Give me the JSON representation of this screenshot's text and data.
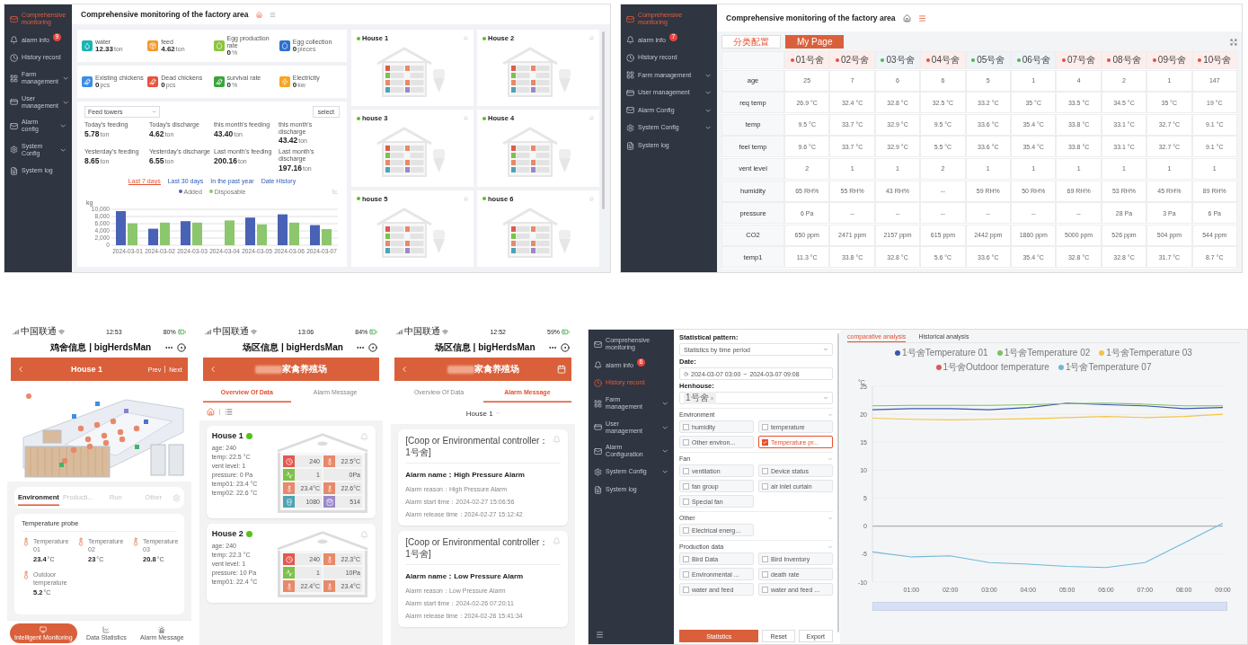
{
  "dashboard": {
    "sidebar": {
      "items": [
        {
          "label": "Comprehensive monitoring",
          "selected": true,
          "expandable": false
        },
        {
          "label": "alarm info",
          "badge": "9",
          "selected": false,
          "expandable": false
        },
        {
          "label": "History record",
          "selected": false,
          "expandable": false
        },
        {
          "label": "Farm management",
          "selected": false,
          "expandable": true
        },
        {
          "label": "User management",
          "selected": false,
          "expandable": true
        },
        {
          "label": "Alarm config",
          "selected": false,
          "expandable": true
        },
        {
          "label": "System Config",
          "selected": false,
          "expandable": true
        },
        {
          "label": "System log",
          "selected": false,
          "expandable": false
        }
      ]
    },
    "title": "Comprehensive monitoring of the factory area",
    "stat_groups": [
      [
        {
          "label": "water",
          "value": "12.33",
          "unit": "ton",
          "color": "#1bb3b3"
        },
        {
          "label": "feed",
          "value": "4.62",
          "unit": "ton",
          "color": "#f39a2b"
        },
        {
          "label": "Egg production rate",
          "value": "0",
          "unit": "%",
          "color": "#8cc43f"
        },
        {
          "label": "Egg collection",
          "value": "0",
          "unit": "pieces",
          "color": "#2f6fd1"
        }
      ],
      [
        {
          "label": "Existing chickens",
          "value": "0",
          "unit": "pcs",
          "color": "#3a8ee6"
        },
        {
          "label": "Dead chickens",
          "value": "0",
          "unit": "pcs",
          "color": "#e8533b"
        },
        {
          "label": "survival rate",
          "value": "0",
          "unit": "%",
          "color": "#3aa43a"
        },
        {
          "label": "Electricity",
          "value": "0",
          "unit": "kw",
          "color": "#f5a623"
        }
      ]
    ],
    "feed_panel": {
      "select": "Feed towers",
      "button": "select",
      "metrics": [
        {
          "label": "Today's feeding",
          "value": "5.78",
          "unit": "ton"
        },
        {
          "label": "Today's discharge",
          "value": "4.62",
          "unit": "ton"
        },
        {
          "label": "this month's feeding",
          "value": "43.40",
          "unit": "ton"
        },
        {
          "label": "this month's discharge",
          "value": "43.42",
          "unit": "ton"
        },
        {
          "label": "Yesterday's feeding",
          "value": "8.65",
          "unit": "ton"
        },
        {
          "label": "Yesterday's discharge",
          "value": "6.55",
          "unit": "ton"
        },
        {
          "label": "Last month's feeding",
          "value": "200.16",
          "unit": "ton"
        },
        {
          "label": "Last month's discharge",
          "value": "197.16",
          "unit": "ton"
        }
      ],
      "chart_tabs": [
        {
          "label": "Last 7 days",
          "selected": true
        },
        {
          "label": "Last 30 days",
          "selected": false
        },
        {
          "label": "In the past year",
          "selected": false
        },
        {
          "label": "Date History",
          "selected": false
        }
      ],
      "chart_data": {
        "type": "bar",
        "grid": true,
        "ylabel": "kg",
        "categories": [
          "2024-03-01",
          "2024-03-02",
          "2024-03-03",
          "2024-03-04",
          "2024-03-05",
          "2024-03-06",
          "2024-03-07"
        ],
        "series": [
          {
            "name": "Added",
            "color": "#4a62b5",
            "values": [
              9500,
              4600,
              6700,
              null,
              7700,
              8600,
              5600
            ]
          },
          {
            "name": "Disposable",
            "color": "#8cc66d",
            "values": [
              6100,
              6300,
              6300,
              6900,
              5800,
              6300,
              4500
            ]
          }
        ],
        "ylim": [
          0,
          10000
        ],
        "yticks": [
          0,
          {
            "value": 2000,
            "label": "2,000"
          },
          {
            "value": 4000,
            "label": "4,000"
          },
          {
            "value": 6000,
            "label": "6,000"
          },
          {
            "value": 8000,
            "label": "8,000"
          },
          {
            "value": 10000,
            "label": "10,000"
          }
        ]
      }
    },
    "houses": [
      {
        "name": "House 1",
        "online": true
      },
      {
        "name": "House 2",
        "online": true
      },
      {
        "name": "house 3",
        "online": true
      },
      {
        "name": "House 4",
        "online": true
      },
      {
        "name": "house 5",
        "online": true
      },
      {
        "name": "house 6",
        "online": true
      }
    ]
  },
  "house_table": {
    "sidebar": {
      "items": [
        {
          "label": "Comprehensive monitoring",
          "selected": true,
          "expandable": false
        },
        {
          "label": "alarm info",
          "badge": "7",
          "selected": false,
          "expandable": false
        },
        {
          "label": "History record",
          "selected": false,
          "expandable": false
        },
        {
          "label": "Farm management",
          "selected": false,
          "expandable": true
        },
        {
          "label": "User management",
          "selected": false,
          "expandable": true
        },
        {
          "label": "Alarm Config",
          "selected": false,
          "expandable": true
        },
        {
          "label": "System Config",
          "selected": false,
          "expandable": true
        },
        {
          "label": "System log",
          "selected": false,
          "expandable": false
        }
      ]
    },
    "title": "Comprehensive monitoring of the factory area",
    "buttons": [
      {
        "label": "分类配置",
        "selected": false
      },
      {
        "label": "My Page",
        "selected": true
      }
    ],
    "columns": [
      {
        "label": "01号舍",
        "color": "#e84a4a"
      },
      {
        "label": "02号舍",
        "color": "#e84a4a"
      },
      {
        "label": "03号舍",
        "color": "#4cb648"
      },
      {
        "label": "04号舍",
        "color": "#e84a4a"
      },
      {
        "label": "05号舍",
        "color": "#4cb648"
      },
      {
        "label": "06号舍",
        "color": "#4cb648"
      },
      {
        "label": "07号舍",
        "color": "#e84a4a"
      },
      {
        "label": "08号舍",
        "color": "#e84a4a"
      },
      {
        "label": "09号舍",
        "color": "#e84a4a"
      },
      {
        "label": "10号舍",
        "color": "#e84a4a"
      }
    ],
    "rows": [
      {
        "label": "age",
        "cells": [
          "25",
          "7",
          "6",
          "6",
          "5",
          "1",
          "4",
          "2",
          "1",
          "147"
        ]
      },
      {
        "label": "req temp",
        "cells": [
          "26.9 °C",
          "32.4 °C",
          "32.8 °C",
          "32.5 °C",
          "33.2 °C",
          "35 °C",
          "33.5 °C",
          "34.5 °C",
          "35 °C",
          "19 °C"
        ]
      },
      {
        "label": "temp",
        "cells": [
          "9.5 °C",
          "33.7 °C",
          "32.9 °C",
          "9.5 °C",
          "33.6 °C",
          "35.4 °C",
          "33.8 °C",
          "33.1 °C",
          "32.7 °C",
          "9.1 °C"
        ]
      },
      {
        "label": "feel temp",
        "cells": [
          "9.6 °C",
          "33.7 °C",
          "32.9 °C",
          "5.5 °C",
          "33.6 °C",
          "35.4 °C",
          "33.8 °C",
          "33.1 °C",
          "32.7 °C",
          "9.1 °C"
        ]
      },
      {
        "label": "vent level",
        "cells": [
          "2",
          "1",
          "1",
          "2",
          "1",
          "1",
          "1",
          "1",
          "1",
          "1"
        ]
      },
      {
        "label": "humidity",
        "cells": [
          "65 RH%",
          "55 RH%",
          "43 RH%",
          "--",
          "59 RH%",
          "50 RH%",
          "69 RH%",
          "53 RH%",
          "45 RH%",
          "89 RH%"
        ]
      },
      {
        "label": "pressure",
        "cells": [
          "6 Pa",
          "--",
          "--",
          "--",
          "--",
          "--",
          "--",
          "28 Pa",
          "3 Pa",
          "6 Pa"
        ]
      },
      {
        "label": "CO2",
        "cells": [
          "650 ppm",
          "2471 ppm",
          "2157 ppm",
          "615 ppm",
          "2442 ppm",
          "1860 ppm",
          "5000 ppm",
          "526 ppm",
          "504 ppm",
          "544 ppm"
        ]
      },
      {
        "label": "temp1",
        "cells": [
          "11.3 °C",
          "33.8 °C",
          "32.8 °C",
          "5.6 °C",
          "33.6 °C",
          "35.4 °C",
          "32.8 °C",
          "32.8 °C",
          "31.7 °C",
          "8.7 °C"
        ]
      }
    ]
  },
  "phones": [
    {
      "kind": "house",
      "status": {
        "carrier": "中国联通",
        "time": "12:53",
        "battery": "80%"
      },
      "app_title": "鸡舍信息 | bigHerdsMan",
      "header": {
        "title": "House 1",
        "prev": "Prev",
        "next": "Next"
      },
      "tabs": [
        {
          "label": "Environment",
          "selected": true
        },
        {
          "label": "Producti...",
          "selected": false
        },
        {
          "label": "Run",
          "selected": false
        },
        {
          "label": "Other",
          "selected": false
        }
      ],
      "probe_card": {
        "title": "Temperature probe",
        "probes": [
          {
            "label": "Temperature 01",
            "value": "23.4",
            "unit": "°C"
          },
          {
            "label": "Temperature 02",
            "value": "23",
            "unit": "°C"
          },
          {
            "label": "Temperature 03",
            "value": "20.8",
            "unit": "°C"
          },
          {
            "label": "Outdoor temperature",
            "value": "5.2",
            "unit": "°C"
          }
        ]
      },
      "nav": [
        {
          "label": "Intelligent Monitoring",
          "selected": true
        },
        {
          "label": "Data Statistics",
          "selected": false
        },
        {
          "label": "Alarm Message",
          "selected": false
        }
      ]
    },
    {
      "kind": "overview",
      "status": {
        "carrier": "中国联通",
        "time": "13:06",
        "battery": "84%"
      },
      "app_title": "场区信息 | bigHerdsMan",
      "header": {
        "title": "家禽养殖场"
      },
      "tabs": [
        {
          "label": "Overview Of Data",
          "selected": true
        },
        {
          "label": "Alarm Message",
          "selected": false
        }
      ],
      "houses": [
        {
          "name": "House 1",
          "online": true,
          "details": [
            "age: 240",
            "temp: 22.5 °C",
            "vent level: 1",
            "pressure: 0 Pa",
            "temp01: 23.4 °C",
            "temp02: 22.6 °C"
          ],
          "cells": [
            "240",
            "22.5°C",
            "1",
            "0Pa",
            "23.4°C",
            "22.6°C",
            "1080",
            "514"
          ]
        },
        {
          "name": "House 2",
          "online": true,
          "details": [
            "age: 240",
            "temp: 22.3 °C",
            "vent level: 1",
            "pressure: 10 Pa",
            "temp01: 22.4 °C"
          ],
          "cells": [
            "240",
            "22.3°C",
            "1",
            "10Pa",
            "22.4°C",
            "23.4°C"
          ]
        }
      ]
    },
    {
      "kind": "alarms",
      "status": {
        "carrier": "中国联通",
        "time": "12:52",
        "battery": "59%"
      },
      "app_title": "场区信息 | bigHerdsMan",
      "header": {
        "title": "家禽养殖场"
      },
      "tabs": [
        {
          "label": "Overview Of Data",
          "selected": false
        },
        {
          "label": "Alarm Message",
          "selected": true
        }
      ],
      "house_select": "House 1",
      "alarms": [
        {
          "source": "[Coop or Environmental controller：1号舍]",
          "name": "Alarm name：High Pressure Alarm",
          "lines": [
            "Alarm reason：High Pressure Alarm",
            "Alarm start time：2024-02-27 15:06:56",
            "Alarm release time：2024-02-27 15:12:42"
          ]
        },
        {
          "source": "[Coop or Environmental controller：1号舍]",
          "name": "Alarm name：Low Pressure Alarm",
          "lines": [
            "Alarm reason：Low Pressure Alarm",
            "Alarm start time：2024-02-26 07:20:11",
            "Alarm release time：2024-02-26 15:41:34"
          ]
        }
      ]
    }
  ],
  "history": {
    "sidebar": {
      "items": [
        {
          "label": "Comprehensive monitoring",
          "selected": false,
          "expandable": false
        },
        {
          "label": "alarm info",
          "badge": "6",
          "selected": false,
          "expandable": false
        },
        {
          "label": "History record",
          "selected": true,
          "expandable": false
        },
        {
          "label": "Farm management",
          "selected": false,
          "expandable": true
        },
        {
          "label": "User management",
          "selected": false,
          "expandable": true
        },
        {
          "label": "Alarm Configuration",
          "selected": false,
          "expandable": true
        },
        {
          "label": "System Config",
          "selected": false,
          "expandable": true
        },
        {
          "label": "System log",
          "selected": false,
          "expandable": false
        }
      ]
    },
    "pattern_label": "Statistical pattern:",
    "pattern": "Statistics by time period",
    "date_label": "Date:",
    "date_start": "2024-03-07 03:00",
    "date_sep": "~",
    "date_end": "2024-03-07 09:08",
    "henhouse_label": "Henhouse:",
    "henhouse_tag": "1号舍",
    "sections": [
      {
        "title": "Environment",
        "options": [
          {
            "label": "humidity",
            "checked": false
          },
          {
            "label": "temperature",
            "checked": false
          },
          {
            "label": "Other environ...",
            "checked": false
          },
          {
            "label": "Temperature pr...",
            "checked": true
          }
        ]
      },
      {
        "title": "Fan",
        "options": [
          {
            "label": "ventilation",
            "checked": false
          },
          {
            "label": "Device status",
            "checked": false
          },
          {
            "label": "fan group",
            "checked": false
          },
          {
            "label": "air inlet curtain",
            "checked": false
          },
          {
            "label": "Special fan",
            "checked": false
          }
        ]
      },
      {
        "title": "Other",
        "options": [
          {
            "label": "Electrical energ...",
            "checked": false
          }
        ]
      },
      {
        "title": "Production data",
        "options": [
          {
            "label": "Bird Data",
            "checked": false
          },
          {
            "label": "Bird Inventory",
            "checked": false
          },
          {
            "label": "Environmental ...",
            "checked": false
          },
          {
            "label": "death rate",
            "checked": false
          },
          {
            "label": "water and feed",
            "checked": false
          },
          {
            "label": "water and feed ...",
            "checked": false
          }
        ]
      }
    ],
    "buttons": [
      {
        "label": "Statistics",
        "primary": true
      },
      {
        "label": "Reset",
        "primary": false
      },
      {
        "label": "Export",
        "primary": false
      }
    ],
    "tabs": [
      {
        "label": "comparative analysis",
        "selected": true
      },
      {
        "label": "Historical analysis",
        "selected": false
      }
    ],
    "range_slider": {
      "level": 1
    },
    "chart_data": {
      "type": "line",
      "grid": true,
      "ylabel": "°C",
      "x": [
        0,
        1,
        2,
        3,
        4,
        5,
        6,
        7,
        8,
        9
      ],
      "series": [
        {
          "name": "1号舍Temperature 01",
          "color": "#3a55b4",
          "values": [
            20.8,
            21,
            21,
            20.8,
            21.2,
            22,
            21.7,
            21.5,
            21,
            21.2
          ]
        },
        {
          "name": "1号舍Temperature 02",
          "color": "#7dc15f",
          "values": [
            21.5,
            21.6,
            21.6,
            21.6,
            21.7,
            21.9,
            22,
            21.8,
            21.5,
            21.5
          ]
        },
        {
          "name": "1号舍Temperature 03",
          "color": "#f3c545",
          "values": [
            19.3,
            19.1,
            19,
            19.1,
            19.2,
            19.4,
            19.6,
            19.4,
            19.6,
            20
          ]
        },
        {
          "name": "1号舍Outdoor temperature",
          "color": "#e05a4f",
          "values": [
            null,
            null,
            null,
            null,
            null,
            null,
            null,
            null,
            null,
            null
          ]
        },
        {
          "name": "1号舍Temperature 07",
          "color": "#6fb8d8",
          "values": [
            -4.6,
            -5.5,
            -5.3,
            -6.5,
            -6.8,
            -7.2,
            -7.4,
            -6.5,
            -3,
            0.5
          ]
        }
      ],
      "ylim": [
        -10,
        25
      ],
      "yticks": [
        -10,
        -5,
        0,
        5,
        10,
        15,
        20,
        25
      ],
      "xlim": [
        0,
        9
      ],
      "xticks": [
        {
          "value": 1,
          "label": "01:00"
        },
        {
          "value": 2,
          "label": "02:00"
        },
        {
          "value": 3,
          "label": "03:00"
        },
        {
          "value": 4,
          "label": "04:00"
        },
        {
          "value": 5,
          "label": "05:00"
        },
        {
          "value": 6,
          "label": "06:00"
        },
        {
          "value": 7,
          "label": "07:00"
        },
        {
          "value": 8,
          "label": "08:00"
        },
        {
          "value": 9,
          "label": "09:00"
        }
      ]
    }
  }
}
